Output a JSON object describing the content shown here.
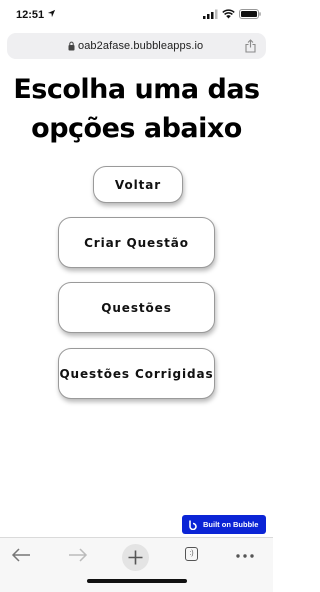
{
  "status_bar": {
    "time": "12:51",
    "icons": [
      "location-arrow-icon",
      "signal-icon",
      "wifi-icon",
      "battery-icon"
    ]
  },
  "browser": {
    "url": "oab2afase.bubbleapps.io",
    "tab_count": ":)"
  },
  "main": {
    "title": "Escolha uma das opções abaixo",
    "buttons": {
      "voltar": "Voltar",
      "criar": "Criar Questão",
      "questoes": "Questões",
      "corrigidas": "Questões Corrigidas"
    }
  },
  "badge": {
    "label": "Built on Bubble",
    "color": "#0b24d6"
  },
  "toolbar": {
    "icons": [
      "back-arrow-icon",
      "forward-arrow-icon",
      "plus-icon",
      "tabs-icon",
      "more-icon"
    ]
  }
}
